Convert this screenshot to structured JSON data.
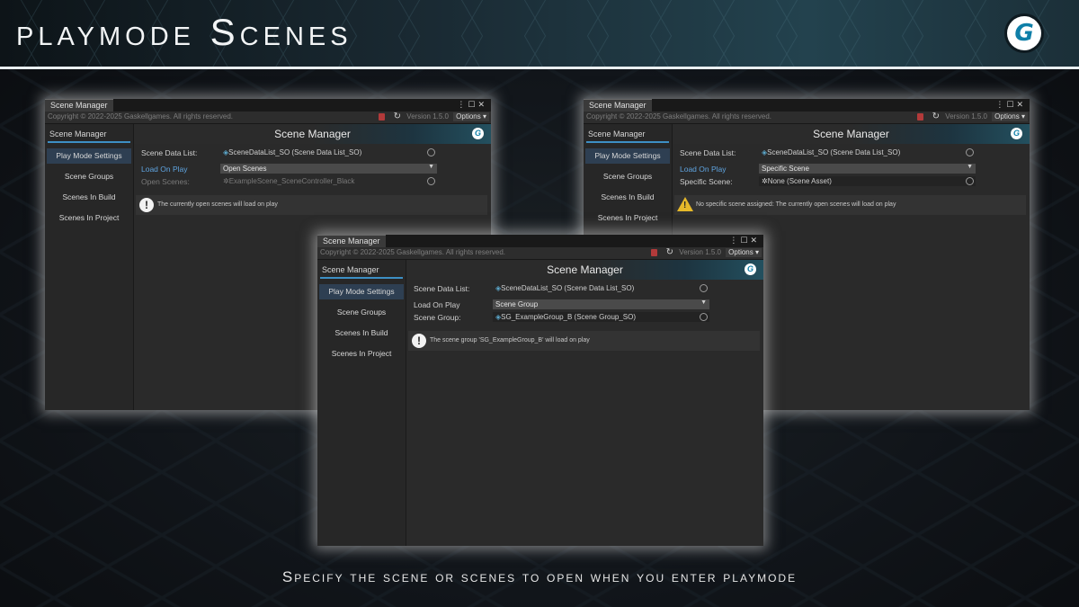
{
  "page": {
    "title": "playmode Scenes",
    "caption": "Specify the scene or scenes to open when you enter playmode",
    "logo_letter": "G"
  },
  "window_common": {
    "tab_label": "Scene Manager",
    "copyright": "Copyright © 2022-2025 Gaskellgames. All rights reserved.",
    "version": "Version 1.5.0",
    "options_label": "Options",
    "sidebar_title": "Scene Manager",
    "sidebar_items": [
      "Play Mode Settings",
      "Scene Groups",
      "Scenes In Build",
      "Scenes In Project"
    ],
    "banner_title": "Scene Manager",
    "scene_data_list_label": "Scene Data List:",
    "scene_data_list_value": "SceneDataList_SO (Scene Data List_SO)",
    "load_on_play_label": "Load On Play"
  },
  "windows": [
    {
      "name": "left",
      "load_on_play_value": "Open Scenes",
      "third_label": "Open Scenes:",
      "third_value": "ExampleScene_SceneController_Black",
      "message": "The currently open scenes will load on play",
      "message_icon": "info-icon"
    },
    {
      "name": "right",
      "load_on_play_value": "Specific Scene",
      "third_label": "Specific Scene:",
      "third_value": "None (Scene Asset)",
      "message": "No specific scene assigned: The currently open scenes will load on play",
      "message_icon": "warning-icon"
    },
    {
      "name": "center",
      "load_on_play_value": "Scene Group",
      "third_label": "Scene Group:",
      "third_value": "SG_ExampleGroup_B (Scene Group_SO)",
      "message": "The scene group 'SG_ExampleGroup_B' will load on play",
      "message_icon": "info-icon"
    }
  ],
  "colors": {
    "accent_blue": "#3d8fc4",
    "label_blue": "#5fa4e0",
    "warning": "#e6b92a",
    "delete_red": "#b23a3a"
  }
}
